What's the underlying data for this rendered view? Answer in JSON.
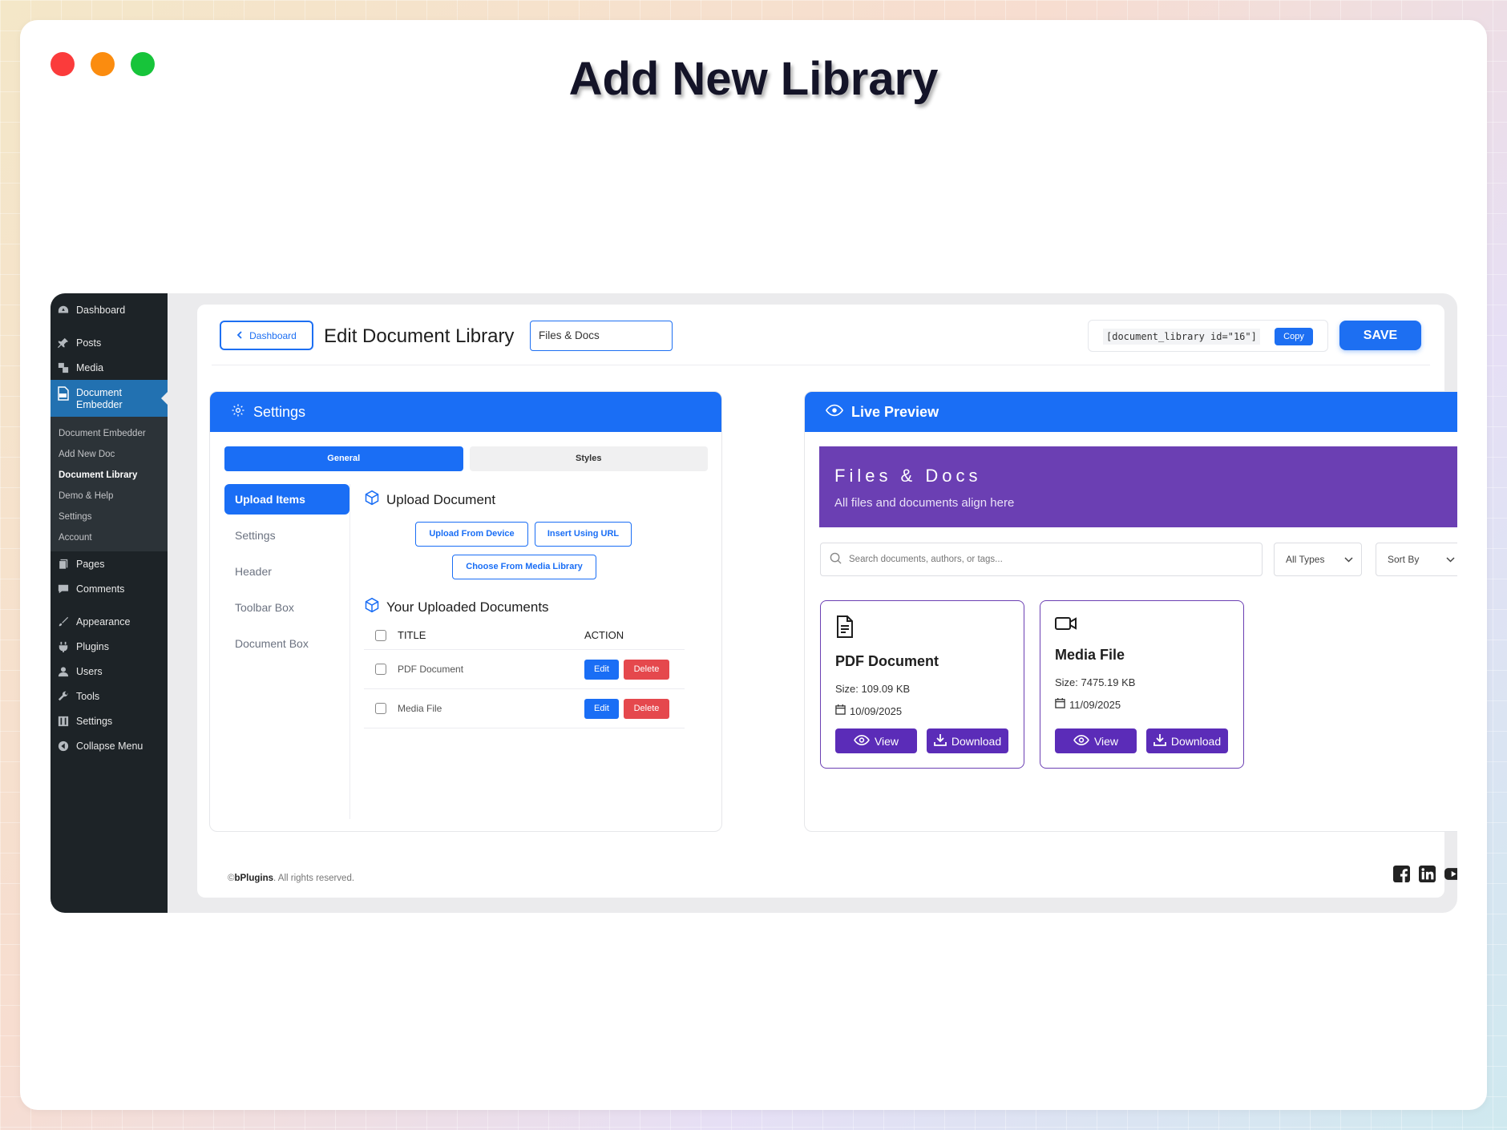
{
  "headline": "Add New Library",
  "wp_menu": {
    "items_top": [
      {
        "label": "Dashboard",
        "icon": "dashboard-icon"
      },
      {
        "label": "Posts",
        "icon": "pin-icon"
      },
      {
        "label": "Media",
        "icon": "media-icon"
      }
    ],
    "active": {
      "line1": "Document",
      "line2": "Embedder",
      "icon": "doc-icon"
    },
    "submenu": [
      "Document Embedder",
      "Add New Doc",
      "Document Library",
      "Demo & Help",
      "Settings",
      "Account"
    ],
    "submenu_current": "Document Library",
    "items_bottom": [
      {
        "label": "Pages",
        "icon": "pages-icon"
      },
      {
        "label": "Comments",
        "icon": "comments-icon"
      },
      {
        "label": "Appearance",
        "icon": "appearance-icon"
      },
      {
        "label": "Plugins",
        "icon": "plugins-icon"
      },
      {
        "label": "Users",
        "icon": "users-icon"
      },
      {
        "label": "Tools",
        "icon": "tools-icon"
      },
      {
        "label": "Settings",
        "icon": "settings-icon"
      },
      {
        "label": "Collapse Menu",
        "icon": "collapse-icon"
      }
    ]
  },
  "topbar": {
    "back_label": "Dashboard",
    "title": "Edit Document Library",
    "title_input_value": "Files & Docs",
    "shortcode": "[document_library id=\"16\"]",
    "copy_label": "Copy",
    "save_label": "SAVE"
  },
  "settings": {
    "heading": "Settings",
    "tabs": [
      "General",
      "Styles"
    ],
    "nav": [
      "Upload Items",
      "Settings",
      "Header",
      "Toolbar Box",
      "Document Box"
    ],
    "upload_title": "Upload Document",
    "btn_device": "Upload From Device",
    "btn_url": "Insert Using URL",
    "btn_media": "Choose From Media Library",
    "uploaded_title": "Your Uploaded Documents",
    "col_title": "TITLE",
    "col_action": "ACTION",
    "rows": [
      {
        "title": "PDF Document",
        "edit": "Edit",
        "delete": "Delete"
      },
      {
        "title": "Media File",
        "edit": "Edit",
        "delete": "Delete"
      }
    ]
  },
  "preview": {
    "heading": "Live Preview",
    "banner_title": "Files & Docs",
    "banner_subtitle": "All files and documents align here",
    "search_placeholder": "Search documents, authors, or tags...",
    "filter_type": "All Types",
    "sort": "Sort By",
    "cards": [
      {
        "icon": "file-text-icon",
        "title": "PDF Document",
        "size": "Size: 109.09 KB",
        "date": "10/09/2025",
        "view": "View",
        "download": "Download"
      },
      {
        "icon": "video-icon",
        "title": "Media File",
        "size": "Size: 7475.19 KB",
        "date": "11/09/2025",
        "view": "View",
        "download": "Download"
      }
    ]
  },
  "footer": {
    "brand": "bPlugins",
    "copyright_prefix": "©",
    "rights": ". All rights reserved."
  },
  "colors": {
    "accent": "#1a6ef5",
    "purple": "#6b3fb3",
    "danger": "#e5484d",
    "wp_sidebar": "#1d2327"
  }
}
